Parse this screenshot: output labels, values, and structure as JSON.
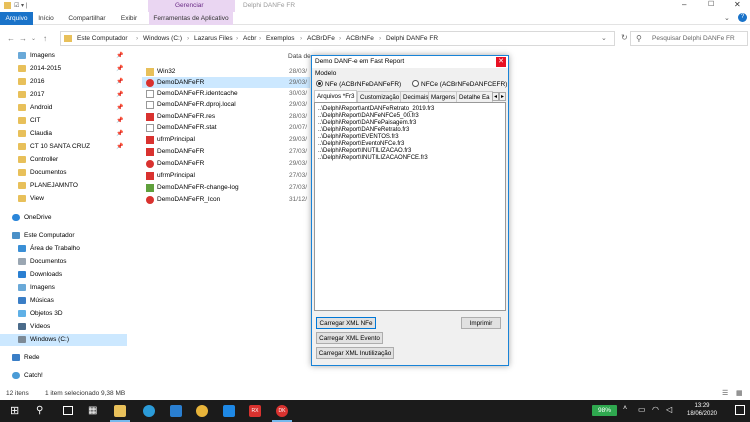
{
  "window": {
    "title": "Delphi DANFe FR",
    "ribbon_context_group": "Gerenciar",
    "ribbon_tabs": [
      "Arquivo",
      "Início",
      "Compartilhar",
      "Exibir",
      "Ferramentas de Aplicativo"
    ]
  },
  "address": {
    "breadcrumbs": [
      "Este Computador",
      "Windows (C:)",
      "Lazarus Files",
      "Acbr",
      "Exemplos",
      "ACBrDFe",
      "ACBrNFe",
      "Delphi DANFe FR"
    ],
    "search_placeholder": "Pesquisar Delphi DANFe FR"
  },
  "nav_pane": {
    "quick_access": [
      {
        "label": "Imagens",
        "pinned": true
      },
      {
        "label": "2014-2015",
        "pinned": true
      },
      {
        "label": "2016",
        "pinned": true
      },
      {
        "label": "2017",
        "pinned": true
      },
      {
        "label": "Android",
        "pinned": true
      },
      {
        "label": "CIT",
        "pinned": true
      },
      {
        "label": "Claudia",
        "pinned": true
      },
      {
        "label": "CT 10 SANTA CRUZ",
        "pinned": true
      },
      {
        "label": "Controller",
        "pinned": false
      },
      {
        "label": "Documentos",
        "pinned": false
      },
      {
        "label": "PLANEJAMNTO",
        "pinned": false
      },
      {
        "label": "View",
        "pinned": false
      }
    ],
    "onedrive": "OneDrive",
    "this_pc": "Este Computador",
    "this_pc_items": [
      "Área de Trabalho",
      "Documentos",
      "Downloads",
      "Imagens",
      "Músicas",
      "Objetos 3D",
      "Vídeos",
      "Windows (C:)"
    ],
    "network": "Rede",
    "catch": "Catch!"
  },
  "file_list": {
    "date_column": "Data de",
    "files": [
      {
        "name": "Win32",
        "date": "28/03/",
        "icon": "folder-icon"
      },
      {
        "name": "DemoDANFeFR",
        "date": "29/03/",
        "icon": "delphi-project-icon",
        "selected": true
      },
      {
        "name": "DemoDANFeFR.identcache",
        "date": "30/03/",
        "icon": "file-icon"
      },
      {
        "name": "DemoDANFeFR.dproj.local",
        "date": "29/03/",
        "icon": "file-icon"
      },
      {
        "name": "DemoDANFeFR.res",
        "date": "28/03/",
        "icon": "res-file-icon"
      },
      {
        "name": "DemoDANFeFR.stat",
        "date": "20/07/",
        "icon": "file-icon"
      },
      {
        "name": "ufrmPrincipal",
        "date": "29/03/",
        "icon": "pas-file-icon"
      },
      {
        "name": "DemoDANFeFR",
        "date": "27/03/",
        "icon": "dpr-file-icon"
      },
      {
        "name": "DemoDANFeFR",
        "date": "29/03/",
        "icon": "delphi-app-icon"
      },
      {
        "name": "ufrmPrincipal",
        "date": "27/03/",
        "icon": "dfm-file-icon"
      },
      {
        "name": "DemoDANFeFR-change-log",
        "date": "27/03/",
        "icon": "changelog-icon"
      },
      {
        "name": "DemoDANFeFR_Icon",
        "date": "31/12/",
        "icon": "ico-file-icon"
      }
    ]
  },
  "status_bar": {
    "count": "12 itens",
    "selection": "1 item selecionado  9,38 MB"
  },
  "dialog": {
    "title": "Demo DANF-e em Fast Report",
    "modelo_label": "Modelo",
    "radio_nfe": "NFe (ACBrNFeDANFeFR)",
    "radio_nfce": "NFCe (ACBrNFeDANFCEFR)",
    "tabs": [
      "Arquivos *Fr3",
      "Customização",
      "Decimais",
      "Margens",
      "Detalhe Ea"
    ],
    "active_tab": 0,
    "files": [
      "..\\Delphi\\Report\\antDANFeRetrato_2019.fr3",
      "..\\Delphi\\Report\\DANFeNFCe5_00.fr3",
      "..\\Delphi\\Report\\DANFePaisagem.fr3",
      "..\\Delphi\\Report\\DANFeRetrato.fr3",
      "..\\Delphi\\Report\\EVENTOS.fr3",
      "..\\Delphi\\Report\\EventoNFCe.fr3",
      "..\\Delphi\\Report\\INUTILIZACAO.fr3",
      "..\\Delphi\\Report\\INUTILIZACAONFCE.fr3"
    ],
    "btn_load_nfe": "Carregar XML NFe",
    "btn_print": "Imprimir",
    "btn_load_event": "Carregar XML Evento",
    "btn_load_inut": "Carregar XML Inutilização"
  },
  "taskbar": {
    "battery": "98%",
    "time": "13:29",
    "date": "18/06/2020"
  },
  "colors": {
    "file_tab": "#1a73c9",
    "context_tab": "#ead6f2",
    "selection": "#cce8ff",
    "taskbar": "#1b1b1b",
    "battery": "#2fa84f"
  }
}
